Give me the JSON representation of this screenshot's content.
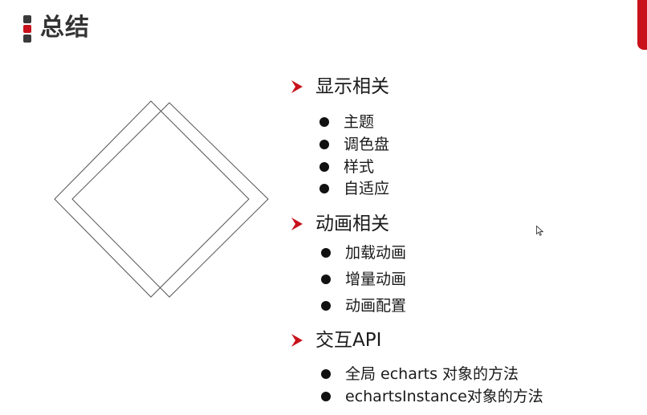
{
  "header": {
    "title": "总结"
  },
  "colors": {
    "accent": "#c8111a",
    "text": "#1a1a1a",
    "title": "#333333"
  },
  "sections": [
    {
      "heading": "显示相关",
      "items": [
        "主题",
        "调色盘",
        "样式",
        "自适应"
      ]
    },
    {
      "heading": "动画相关",
      "items": [
        "加载动画",
        "增量动画",
        "动画配置"
      ]
    },
    {
      "heading": "交互API",
      "items": [
        "全局 echarts 对象的方法",
        "echartsInstance对象的方法"
      ]
    }
  ],
  "icons": {
    "section_marker": "red-chevron-arrow-icon",
    "bullet": "bullet-dot-icon",
    "decor": "overlapping-diamonds-graphic",
    "pointer": "mouse-pointer-icon"
  }
}
